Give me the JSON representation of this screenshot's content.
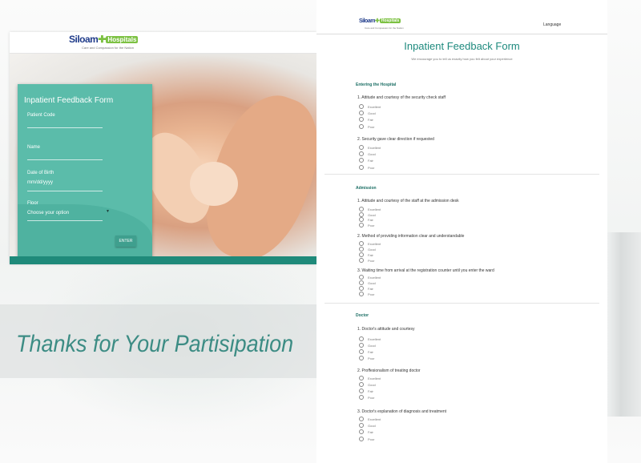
{
  "login_screen": {
    "logo": {
      "word": "Siloam",
      "badge": "Hospitals",
      "tagline": "Care and Compassion for the Nation"
    },
    "card_title": "Inpatient Feedback Form",
    "fields": [
      {
        "label": "Patient Code",
        "value": ""
      },
      {
        "label": "Name",
        "value": ""
      },
      {
        "label": "Date of Birth",
        "value": "mm/dd/yyyy"
      },
      {
        "label": "Floor",
        "value": "Choose your option"
      }
    ],
    "enter_label": "ENTER"
  },
  "banner": {
    "text": "Thanks for Your Partisipation"
  },
  "form_screen": {
    "logo": {
      "word": "Siloam",
      "badge": "Hospitals",
      "tagline": "Care and Compassion for the Nation"
    },
    "language": "Language",
    "title": "Inpatient Feedback Form",
    "subtitle": "We encourage you to tell us exactly how you felt about your experience",
    "options": [
      "Excellent",
      "Good",
      "Fair",
      "Poor"
    ],
    "sections": [
      {
        "title": "Entering the Hospital",
        "questions": [
          "1. Attitude and courtesy of the security check staff",
          "2. Security gave clear direction if requested"
        ]
      },
      {
        "title": "Admission",
        "questions": [
          "1. Attitude and courtesy of the staff at the admission desk",
          "2. Method of providing information clear and understandable",
          "3. Waiting time from arrival at the registration counter until you enter the ward"
        ]
      },
      {
        "title": "Doctor",
        "questions": [
          "1. Doctor's attitude and courtesy",
          "2. Proffesionalism of treating doctor",
          "3. Doctor's explanation of diagnosis and treatment"
        ]
      }
    ]
  },
  "colors": {
    "teal": "#5bbcaa",
    "dark_teal": "#1e8a7e",
    "banner_text": "#3c8c84",
    "logo_blue": "#1f3b8a",
    "logo_green": "#7cc142"
  }
}
